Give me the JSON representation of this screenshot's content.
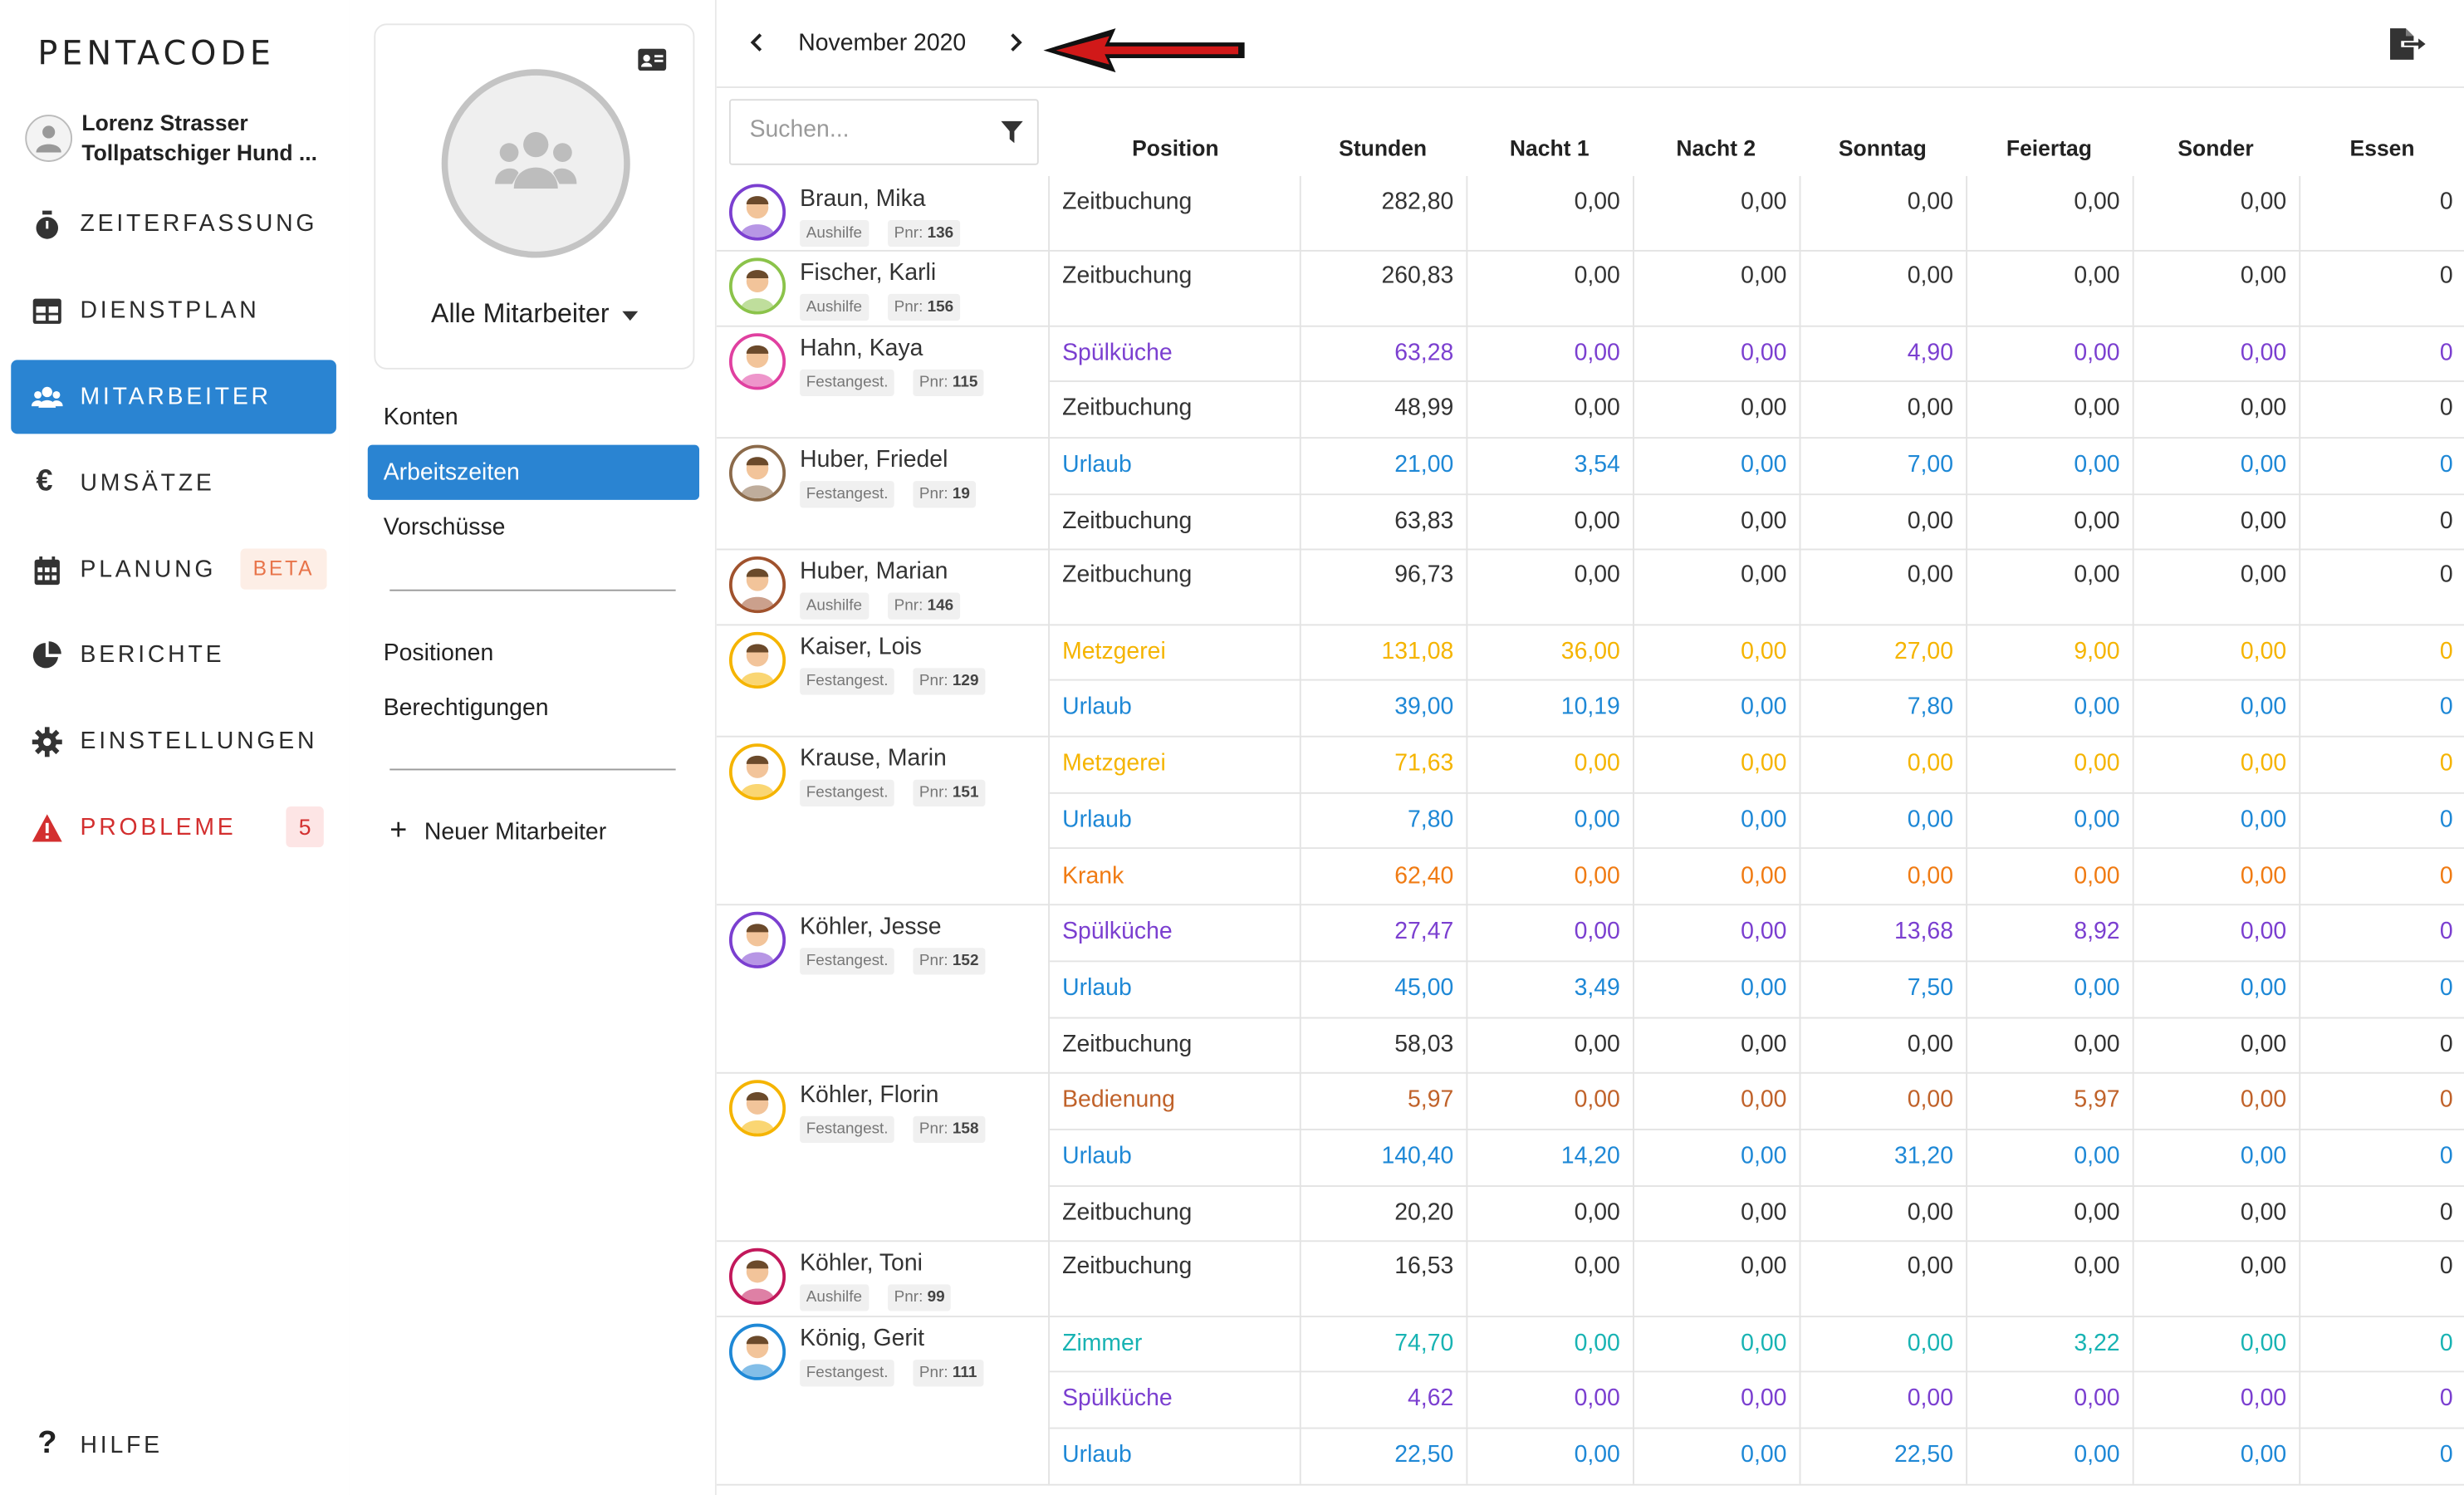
{
  "brand": {
    "logo": "PENTACODE"
  },
  "user": {
    "name": "Lorenz Strasser",
    "company": "Tollpatschiger Hund ..."
  },
  "nav": {
    "items": [
      {
        "key": "zeit",
        "label": "ZEITERFASSUNG",
        "icon": "stopwatch-icon",
        "active": false
      },
      {
        "key": "dienst",
        "label": "DIENSTPLAN",
        "icon": "table-icon",
        "active": false
      },
      {
        "key": "mitarbeiter",
        "label": "MITARBEITER",
        "icon": "users-icon",
        "active": true
      },
      {
        "key": "umsaetze",
        "label": "UMSÄTZE",
        "icon": "euro-icon",
        "active": false
      },
      {
        "key": "planung",
        "label": "PLANUNG",
        "icon": "calendar-icon",
        "active": false,
        "badge": "BETA"
      },
      {
        "key": "berichte",
        "label": "BERICHTE",
        "icon": "pie-chart-icon",
        "active": false
      },
      {
        "key": "einstellungen",
        "label": "EINSTELLUNGEN",
        "icon": "gear-icon",
        "active": false
      },
      {
        "key": "probleme",
        "label": "PROBLEME",
        "icon": "warning-icon",
        "active": false,
        "badge": "5"
      }
    ],
    "help": "HILFE"
  },
  "panel": {
    "group": "Alle Mitarbeiter",
    "menu_a": [
      "Konten",
      "Arbeitszeiten",
      "Vorschüsse"
    ],
    "menu_b": [
      "Positionen",
      "Berechtigungen"
    ],
    "active": "Arbeitszeiten",
    "new_employee": "Neuer Mitarbeiter"
  },
  "header": {
    "month": "November 2020"
  },
  "search": {
    "placeholder": "Suchen..."
  },
  "columns": [
    "Position",
    "Stunden",
    "Nacht 1",
    "Nacht 2",
    "Sonntag",
    "Feiertag",
    "Sonder",
    "Essen"
  ],
  "colors": {
    "Zeitbuchung": "#333333",
    "Spülküche": "#7b3fd0",
    "Urlaub": "#1e88d6",
    "Metzgerei": "#f5b400",
    "Krank": "#f07b13",
    "Bedienung": "#c0622a",
    "Zimmer": "#18b3b3",
    "accent": "#2a84d2",
    "danger": "#d32f2f"
  },
  "employees": [
    {
      "name": "Braun, Mika",
      "type": "Aushilfe",
      "pnr": "136",
      "ring": "#7b3fd0",
      "rows": [
        {
          "position": "Zeitbuchung",
          "values": [
            "282,80",
            "0,00",
            "0,00",
            "0,00",
            "0,00",
            "0,00",
            "0"
          ]
        }
      ]
    },
    {
      "name": "Fischer, Karli",
      "type": "Aushilfe",
      "pnr": "156",
      "ring": "#8bc34a",
      "rows": [
        {
          "position": "Zeitbuchung",
          "values": [
            "260,83",
            "0,00",
            "0,00",
            "0,00",
            "0,00",
            "0,00",
            "0"
          ]
        }
      ]
    },
    {
      "name": "Hahn, Kaya",
      "type": "Festangest.",
      "pnr": "115",
      "ring": "#e040a0",
      "rows": [
        {
          "position": "Spülküche",
          "values": [
            "63,28",
            "0,00",
            "0,00",
            "4,90",
            "0,00",
            "0,00",
            "0"
          ]
        },
        {
          "position": "Zeitbuchung",
          "values": [
            "48,99",
            "0,00",
            "0,00",
            "0,00",
            "0,00",
            "0,00",
            "0"
          ]
        }
      ]
    },
    {
      "name": "Huber, Friedel",
      "type": "Festangest.",
      "pnr": "19",
      "ring": "#8b6a4a",
      "rows": [
        {
          "position": "Urlaub",
          "values": [
            "21,00",
            "3,54",
            "0,00",
            "7,00",
            "0,00",
            "0,00",
            "0"
          ]
        },
        {
          "position": "Zeitbuchung",
          "values": [
            "63,83",
            "0,00",
            "0,00",
            "0,00",
            "0,00",
            "0,00",
            "0"
          ]
        }
      ]
    },
    {
      "name": "Huber, Marian",
      "type": "Aushilfe",
      "pnr": "146",
      "ring": "#a0522d",
      "rows": [
        {
          "position": "Zeitbuchung",
          "values": [
            "96,73",
            "0,00",
            "0,00",
            "0,00",
            "0,00",
            "0,00",
            "0"
          ]
        }
      ]
    },
    {
      "name": "Kaiser, Lois",
      "type": "Festangest.",
      "pnr": "129",
      "ring": "#f5b400",
      "rows": [
        {
          "position": "Metzgerei",
          "values": [
            "131,08",
            "36,00",
            "0,00",
            "27,00",
            "9,00",
            "0,00",
            "0"
          ]
        },
        {
          "position": "Urlaub",
          "values": [
            "39,00",
            "10,19",
            "0,00",
            "7,80",
            "0,00",
            "0,00",
            "0"
          ]
        }
      ]
    },
    {
      "name": "Krause, Marin",
      "type": "Festangest.",
      "pnr": "151",
      "ring": "#f5b400",
      "rows": [
        {
          "position": "Metzgerei",
          "values": [
            "71,63",
            "0,00",
            "0,00",
            "0,00",
            "0,00",
            "0,00",
            "0"
          ]
        },
        {
          "position": "Urlaub",
          "values": [
            "7,80",
            "0,00",
            "0,00",
            "0,00",
            "0,00",
            "0,00",
            "0"
          ]
        },
        {
          "position": "Krank",
          "values": [
            "62,40",
            "0,00",
            "0,00",
            "0,00",
            "0,00",
            "0,00",
            "0"
          ]
        }
      ]
    },
    {
      "name": "Köhler, Jesse",
      "type": "Festangest.",
      "pnr": "152",
      "ring": "#7b3fd0",
      "rows": [
        {
          "position": "Spülküche",
          "values": [
            "27,47",
            "0,00",
            "0,00",
            "13,68",
            "8,92",
            "0,00",
            "0"
          ]
        },
        {
          "position": "Urlaub",
          "values": [
            "45,00",
            "3,49",
            "0,00",
            "7,50",
            "0,00",
            "0,00",
            "0"
          ]
        },
        {
          "position": "Zeitbuchung",
          "values": [
            "58,03",
            "0,00",
            "0,00",
            "0,00",
            "0,00",
            "0,00",
            "0"
          ]
        }
      ]
    },
    {
      "name": "Köhler, Florin",
      "type": "Festangest.",
      "pnr": "158",
      "ring": "#f5b400",
      "rows": [
        {
          "position": "Bedienung",
          "values": [
            "5,97",
            "0,00",
            "0,00",
            "0,00",
            "5,97",
            "0,00",
            "0"
          ]
        },
        {
          "position": "Urlaub",
          "values": [
            "140,40",
            "14,20",
            "0,00",
            "31,20",
            "0,00",
            "0,00",
            "0"
          ]
        },
        {
          "position": "Zeitbuchung",
          "values": [
            "20,20",
            "0,00",
            "0,00",
            "0,00",
            "0,00",
            "0,00",
            "0"
          ]
        }
      ]
    },
    {
      "name": "Köhler, Toni",
      "type": "Aushilfe",
      "pnr": "99",
      "ring": "#c2185b",
      "rows": [
        {
          "position": "Zeitbuchung",
          "values": [
            "16,53",
            "0,00",
            "0,00",
            "0,00",
            "0,00",
            "0,00",
            "0"
          ]
        }
      ]
    },
    {
      "name": "König, Gerit",
      "type": "Festangest.",
      "pnr": "111",
      "ring": "#1e88d6",
      "rows": [
        {
          "position": "Zimmer",
          "values": [
            "74,70",
            "0,00",
            "0,00",
            "0,00",
            "3,22",
            "0,00",
            "0"
          ]
        },
        {
          "position": "Spülküche",
          "values": [
            "4,62",
            "0,00",
            "0,00",
            "0,00",
            "0,00",
            "0,00",
            "0"
          ]
        },
        {
          "position": "Urlaub",
          "values": [
            "22,50",
            "0,00",
            "0,00",
            "22,50",
            "0,00",
            "0,00",
            "0"
          ]
        }
      ]
    }
  ]
}
